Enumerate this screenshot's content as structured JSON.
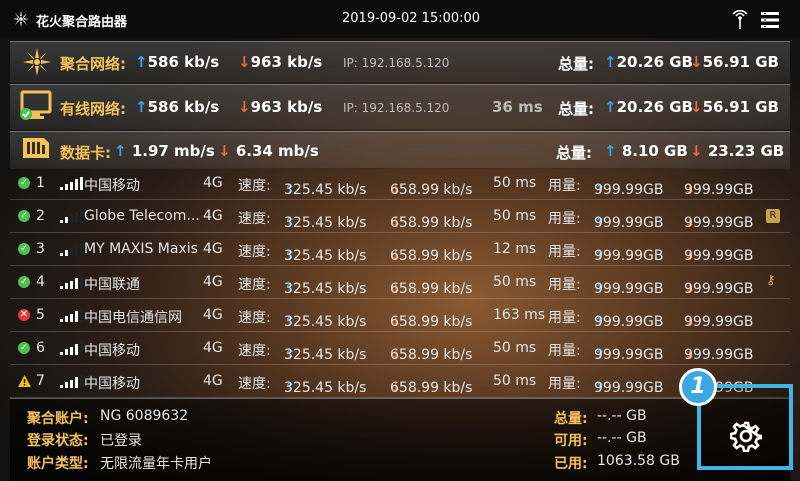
{
  "topbar": {
    "app_title": "花火聚合路由器",
    "datetime": "2019-09-02   15:00:00"
  },
  "aggregate": {
    "label": "聚合网络:",
    "up": "586 kb/s",
    "down": "963 kb/s",
    "ip": "IP:  192.168.5.120",
    "total_label": "总量:",
    "total_up": "20.26 GB",
    "total_down": "56.91 GB"
  },
  "wired": {
    "label": "有线网络:",
    "up": "586 kb/s",
    "down": "963 kb/s",
    "ip": "IP:  192.168.5.120",
    "latency": "36 ms",
    "total_label": "总量:",
    "total_up": "20.26 GB",
    "total_down": "56.91 GB"
  },
  "datacard": {
    "label": "数据卡:",
    "up": "1.97 mb/s",
    "down": "6.34 mb/s",
    "total_label": "总量:",
    "total_up": "8.10 GB",
    "total_down": "23.23 GB"
  },
  "sims": [
    {
      "status": "ok",
      "index": "1",
      "bars": 5,
      "carrier": "中国移动",
      "net": "4G",
      "speed_label": "速度:",
      "up": "325.45 kb/s",
      "down": "658.99 kb/s",
      "latency": "50 ms",
      "usage_label": "用量:",
      "usage_up": "999.99GB",
      "usage_down": "999.99GB",
      "extra": ""
    },
    {
      "status": "ok",
      "index": "2",
      "bars": 2,
      "carrier": "Globe Telecom...",
      "net": "4G",
      "speed_label": "速度:",
      "up": "325.45 kb/s",
      "down": "658.99 kb/s",
      "latency": "50 ms",
      "usage_label": "用量:",
      "usage_up": "999.99GB",
      "usage_down": "999.99GB",
      "extra": "roam"
    },
    {
      "status": "ok",
      "index": "3",
      "bars": 2,
      "carrier": "MY MAXIS Maxis",
      "net": "4G",
      "speed_label": "速度:",
      "up": "325.45 kb/s",
      "down": "658.99 kb/s",
      "latency": "12 ms",
      "usage_label": "用量:",
      "usage_up": "999.99GB",
      "usage_down": "999.99GB",
      "extra": ""
    },
    {
      "status": "ok",
      "index": "4",
      "bars": 4,
      "carrier": "中国联通",
      "net": "4G",
      "speed_label": "速度:",
      "up": "325.45 kb/s",
      "down": "658.99 kb/s",
      "latency": "50 ms",
      "usage_label": "用量:",
      "usage_up": "999.99GB",
      "usage_down": "999.99GB",
      "extra": "key"
    },
    {
      "status": "err",
      "index": "5",
      "bars": 4,
      "carrier": "中国电信通信网",
      "net": "4G",
      "speed_label": "速度:",
      "up": "325.45 kb/s",
      "down": "658.99 kb/s",
      "latency": "163 ms",
      "usage_label": "用量:",
      "usage_up": "999.99GB",
      "usage_down": "999.99GB",
      "extra": ""
    },
    {
      "status": "ok",
      "index": "6",
      "bars": 4,
      "carrier": "中国移动",
      "net": "4G",
      "speed_label": "速度:",
      "up": "325.45 kb/s",
      "down": "658.99 kb/s",
      "latency": "50 ms",
      "usage_label": "用量:",
      "usage_up": "999.99GB",
      "usage_down": "999.99GB",
      "extra": ""
    },
    {
      "status": "warn",
      "index": "7",
      "bars": 4,
      "carrier": "中国移动",
      "net": "4G",
      "speed_label": "速度:",
      "up": "325.45 kb/s",
      "down": "658.99 kb/s",
      "latency": "50 ms",
      "usage_label": "用量:",
      "usage_up": "999.99GB",
      "usage_down": "999.99GB",
      "extra": ""
    }
  ],
  "footer": {
    "account_label": "聚合账户:",
    "account_value": "NG 6089632",
    "login_label": "登录状态:",
    "login_value": "已登录",
    "type_label": "账户类型:",
    "type_value": "无限流量年卡用户",
    "total_label": "总量:",
    "total_value": "--.-- GB",
    "avail_label": "可用:",
    "avail_value": "--.-- GB",
    "used_label": "已用:",
    "used_value": "1063.58 GB"
  },
  "callout": {
    "badge": "1"
  },
  "colors": {
    "accent_gold": "#f2c25a",
    "up_blue": "#3aa3e8",
    "down_orange": "#e86b3a",
    "ok_green": "#4cc24c",
    "err_red": "#e23a3a",
    "warn_yellow": "#f2c21a",
    "highlight_cyan": "#41b4e6"
  },
  "icons": {
    "logo": "firework-logo-icon",
    "signal": "signal-tower-icon",
    "menu": "list-menu-icon",
    "wired": "monitor-icon",
    "sim": "sim-card-icon",
    "settings": "gear-icon"
  }
}
